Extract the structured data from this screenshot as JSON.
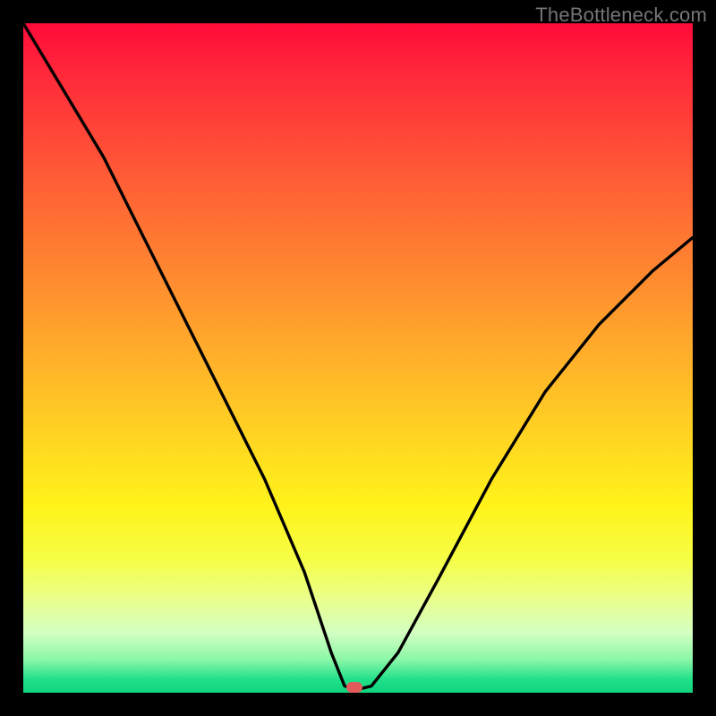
{
  "watermark": "TheBottleneck.com",
  "marker": {
    "color": "#e35b5b",
    "x_pct": 49.5,
    "y_pct": 99.2
  },
  "chart_data": {
    "type": "line",
    "title": "",
    "xlabel": "",
    "ylabel": "",
    "xlim": [
      0,
      100
    ],
    "ylim": [
      0,
      100
    ],
    "grid": false,
    "legend": false,
    "series": [
      {
        "name": "bottleneck-curve",
        "x": [
          0,
          6,
          12,
          18,
          24,
          30,
          36,
          42,
          46,
          48,
          50,
          52,
          56,
          62,
          70,
          78,
          86,
          94,
          100
        ],
        "y": [
          100,
          90,
          80,
          68,
          56,
          44,
          32,
          18,
          6,
          1,
          0.5,
          1,
          6,
          17,
          32,
          45,
          55,
          63,
          68
        ]
      }
    ],
    "background_gradient": {
      "orientation": "vertical",
      "stops": [
        {
          "pos": 0.0,
          "color": "#ff0b3a"
        },
        {
          "pos": 0.22,
          "color": "#ff5936"
        },
        {
          "pos": 0.5,
          "color": "#ffb02a"
        },
        {
          "pos": 0.72,
          "color": "#fff31a"
        },
        {
          "pos": 0.91,
          "color": "#d3ffc2"
        },
        {
          "pos": 1.0,
          "color": "#0fd57e"
        }
      ]
    },
    "annotations": [
      {
        "type": "marker",
        "x": 49.5,
        "y": 0.8,
        "shape": "pill",
        "color": "#e35b5b"
      }
    ]
  }
}
